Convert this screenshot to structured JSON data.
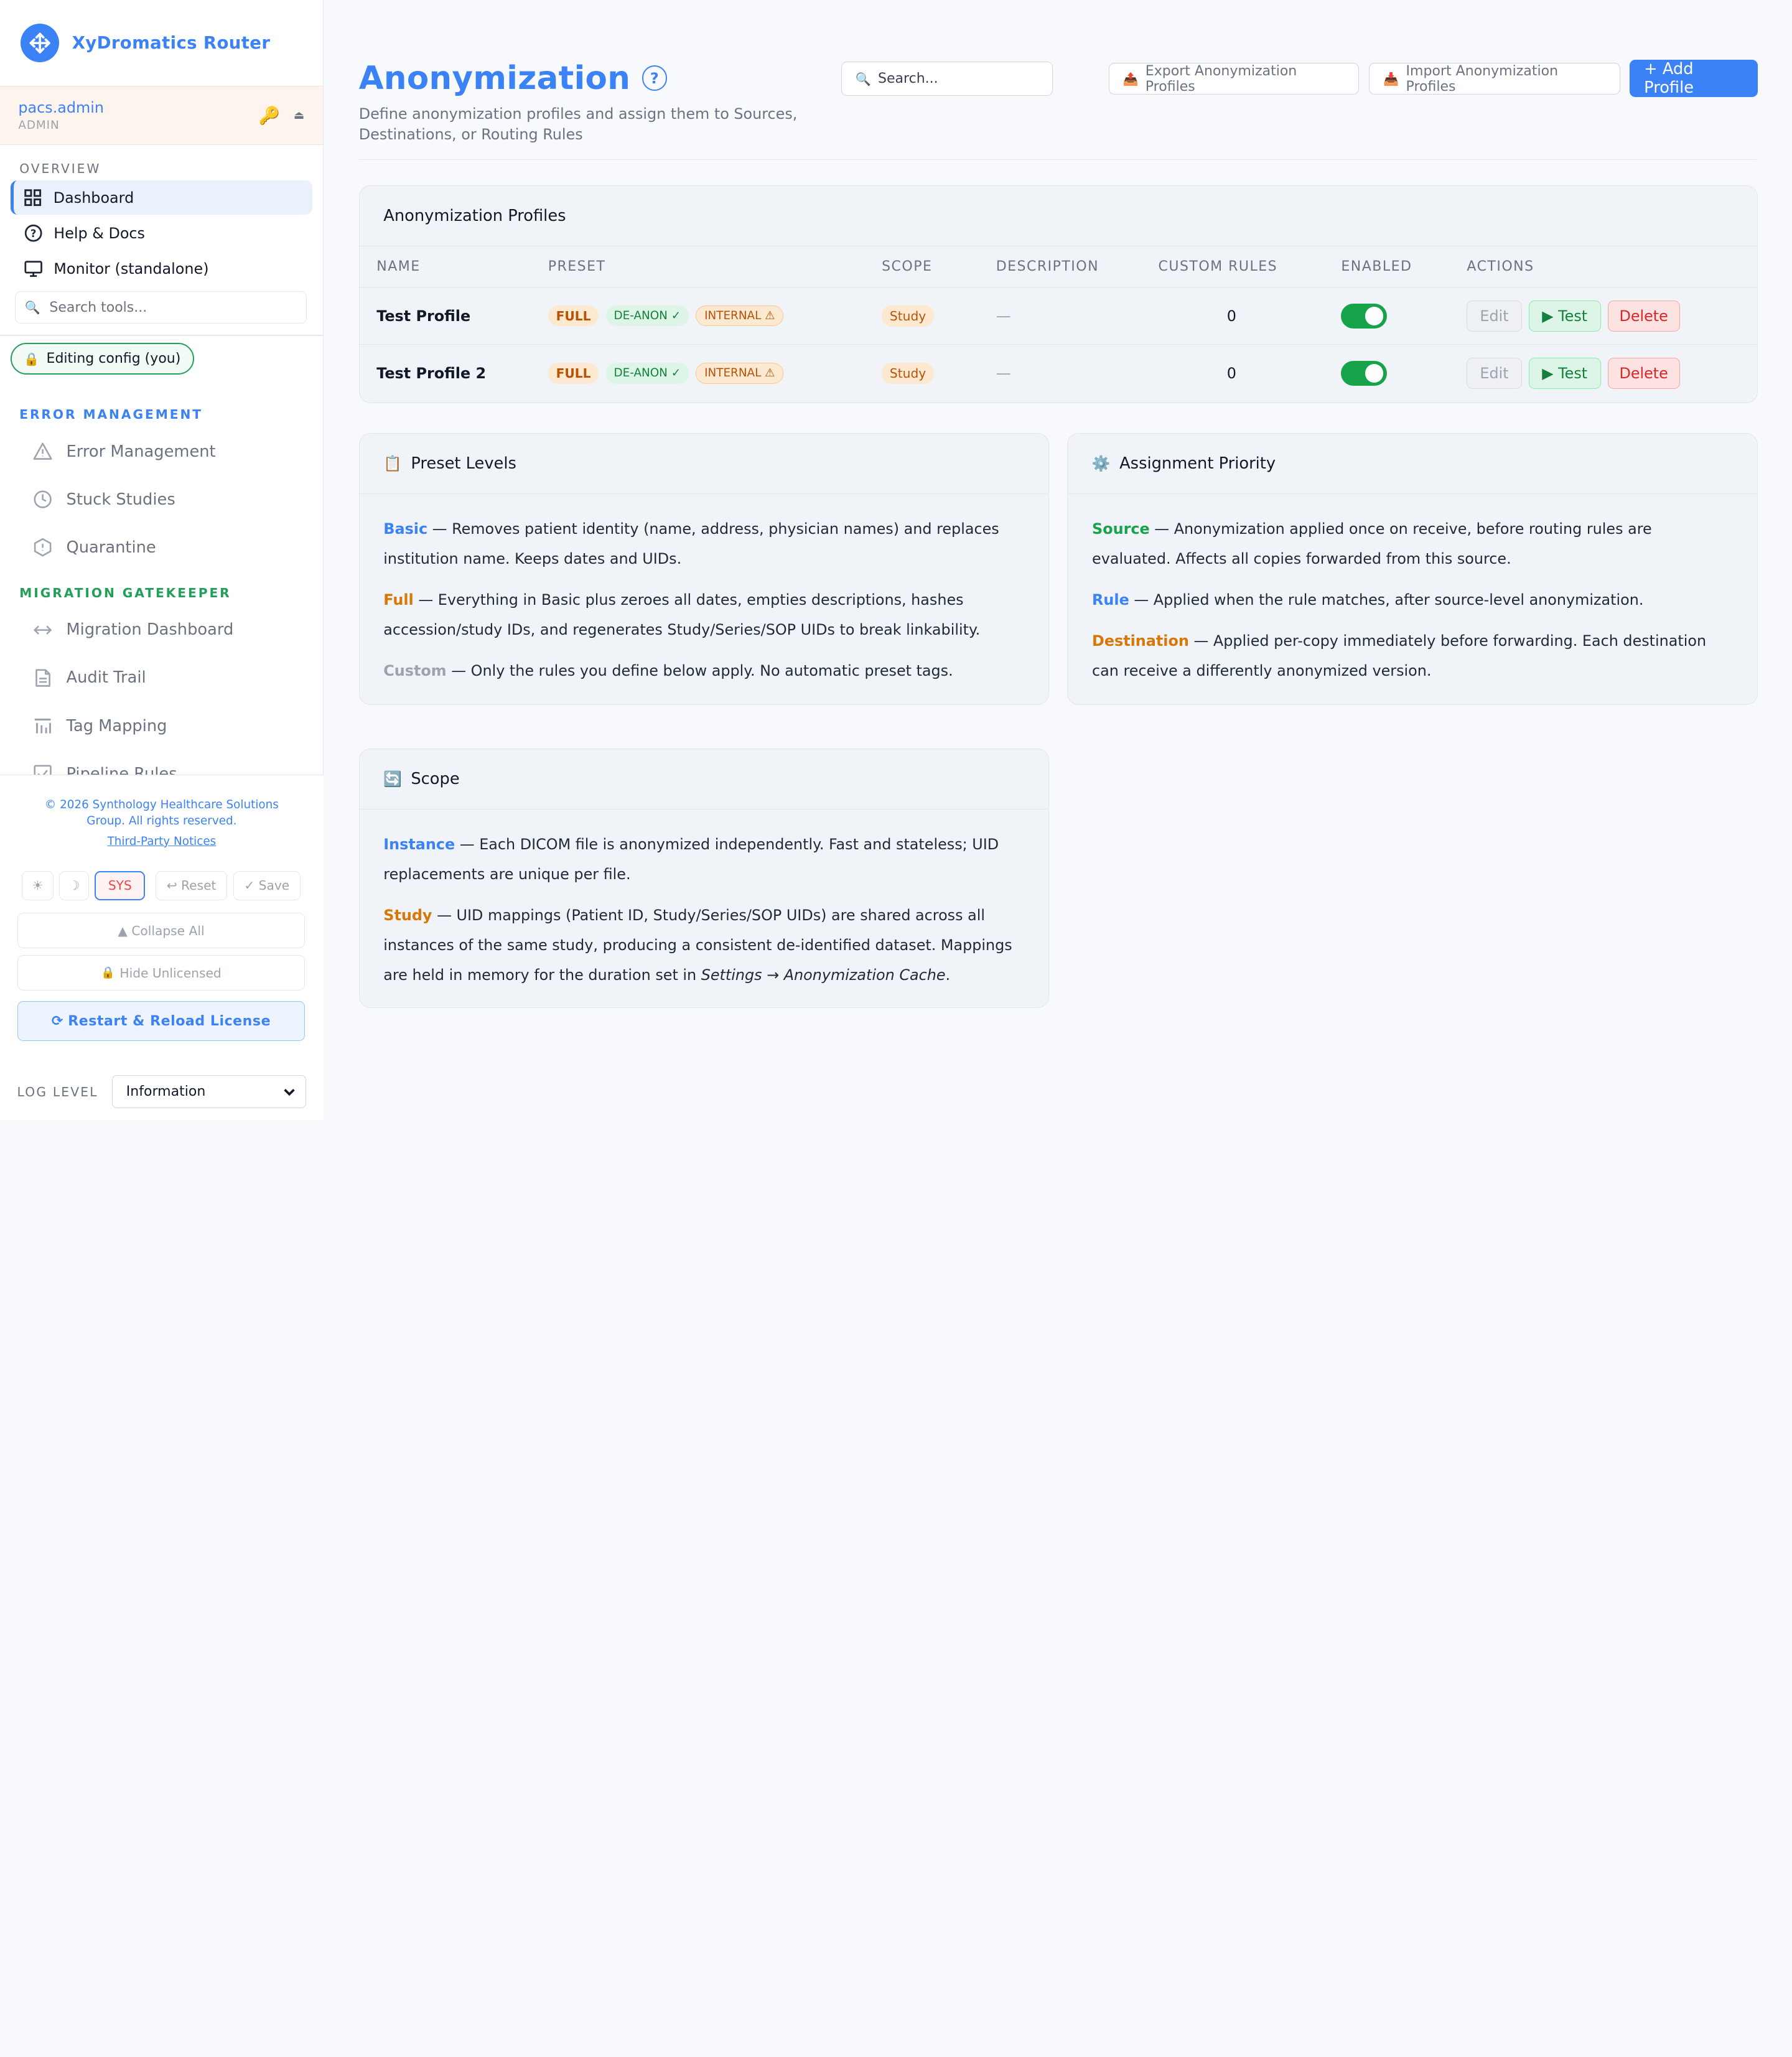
{
  "app": {
    "name": "XyDromatics Router"
  },
  "user": {
    "name": "pacs.admin",
    "role": "ADMIN"
  },
  "sidebar": {
    "overview_label": "OVERVIEW",
    "overview_items": [
      "Dashboard",
      "Help & Docs",
      "Monitor (standalone)"
    ],
    "tools_search_placeholder": "Search tools...",
    "editing_pill": "Editing config (you)",
    "error_section_label": "ERROR MANAGEMENT",
    "error_items": [
      "Error Management",
      "Stuck Studies",
      "Quarantine"
    ],
    "migration_section_label": "MIGRATION GATEKEEPER",
    "migration_items": [
      "Migration Dashboard",
      "Audit Trail",
      "Tag Mapping",
      "Pipeline Rules"
    ]
  },
  "footer": {
    "copyright_line1": "© 2026 Synthology Healthcare Solutions",
    "copyright_line2": "Group. All rights reserved.",
    "third_party": "Third-Party Notices",
    "theme_light": "☀",
    "theme_dark": "☽",
    "theme_sys": "SYS",
    "reset": "↩ Reset",
    "save": "✓ Save",
    "collapse_all": "▲ Collapse All",
    "hide_unlicensed": "Hide Unlicensed",
    "restart": "Restart & Reload License",
    "log_level_label": "LOG LEVEL",
    "log_level_value": "Information"
  },
  "header": {
    "title": "Anonymization",
    "subtitle": "Define anonymization profiles and assign them to Sources, Destinations, or Routing Rules",
    "search_placeholder": "Search...",
    "export_label": "Export Anonymization Profiles",
    "import_label": "Import Anonymization Profiles",
    "add_label": "+ Add Profile"
  },
  "profiles": {
    "title": "Anonymization Profiles",
    "columns": [
      "NAME",
      "PRESET",
      "SCOPE",
      "DESCRIPTION",
      "CUSTOM RULES",
      "ENABLED",
      "ACTIONS"
    ],
    "rows": [
      {
        "name": "Test Profile",
        "preset": "FULL",
        "deanon": "DE-ANON ✓",
        "internal": "INTERNAL ⚠",
        "scope": "Study",
        "description": "—",
        "custom_rules": "0",
        "enabled": true
      },
      {
        "name": "Test Profile 2",
        "preset": "FULL",
        "deanon": "DE-ANON ✓",
        "internal": "INTERNAL ⚠",
        "scope": "Study",
        "description": "—",
        "custom_rules": "0",
        "enabled": true
      }
    ],
    "actions": {
      "edit": "Edit",
      "test": "▶ Test",
      "delete": "Delete"
    }
  },
  "preset_levels": {
    "title": "Preset Levels",
    "items": [
      {
        "key": "Basic",
        "text": " — Removes patient identity (name, address, physician names) and replaces institution name. Keeps dates and UIDs.",
        "color": "#3b82f6"
      },
      {
        "key": "Full",
        "text": " — Everything in Basic plus zeroes all dates, empties descriptions, hashes accession/study IDs, and regenerates Study/Series/SOP UIDs to break linkability.",
        "color": "#d97706"
      },
      {
        "key": "Custom",
        "text": " — Only the rules you define below apply. No automatic preset tags.",
        "color": "#9ca3af"
      }
    ]
  },
  "assignment_priority": {
    "title": "Assignment Priority",
    "items": [
      {
        "key": "Source",
        "text": " — Anonymization applied once on receive, before routing rules are evaluated. Affects all copies forwarded from this source.",
        "color": "#16a34a"
      },
      {
        "key": "Rule",
        "text": " — Applied when the rule matches, after source-level anonymization.",
        "color": "#3b82f6"
      },
      {
        "key": "Destination",
        "text": " — Applied per-copy immediately before forwarding. Each destination can receive a differently anonymized version.",
        "color": "#d97706"
      }
    ]
  },
  "scope_info": {
    "title": "Scope",
    "instance_key": "Instance",
    "instance_text": " — Each DICOM file is anonymized independently. Fast and stateless; UID replacements are unique per file.",
    "study_key": "Study",
    "study_text": " — UID mappings (Patient ID, Study/Series/SOP UIDs) are shared across all instances of the same study, producing a consistent de-identified dataset. Mappings are held in memory for the duration set in ",
    "study_path": "Settings → Anonymization Cache",
    "study_end": "."
  },
  "colors": {
    "accent": "#3b82f6",
    "success": "#16a34a",
    "warning": "#d97706",
    "danger": "#dc2626"
  }
}
